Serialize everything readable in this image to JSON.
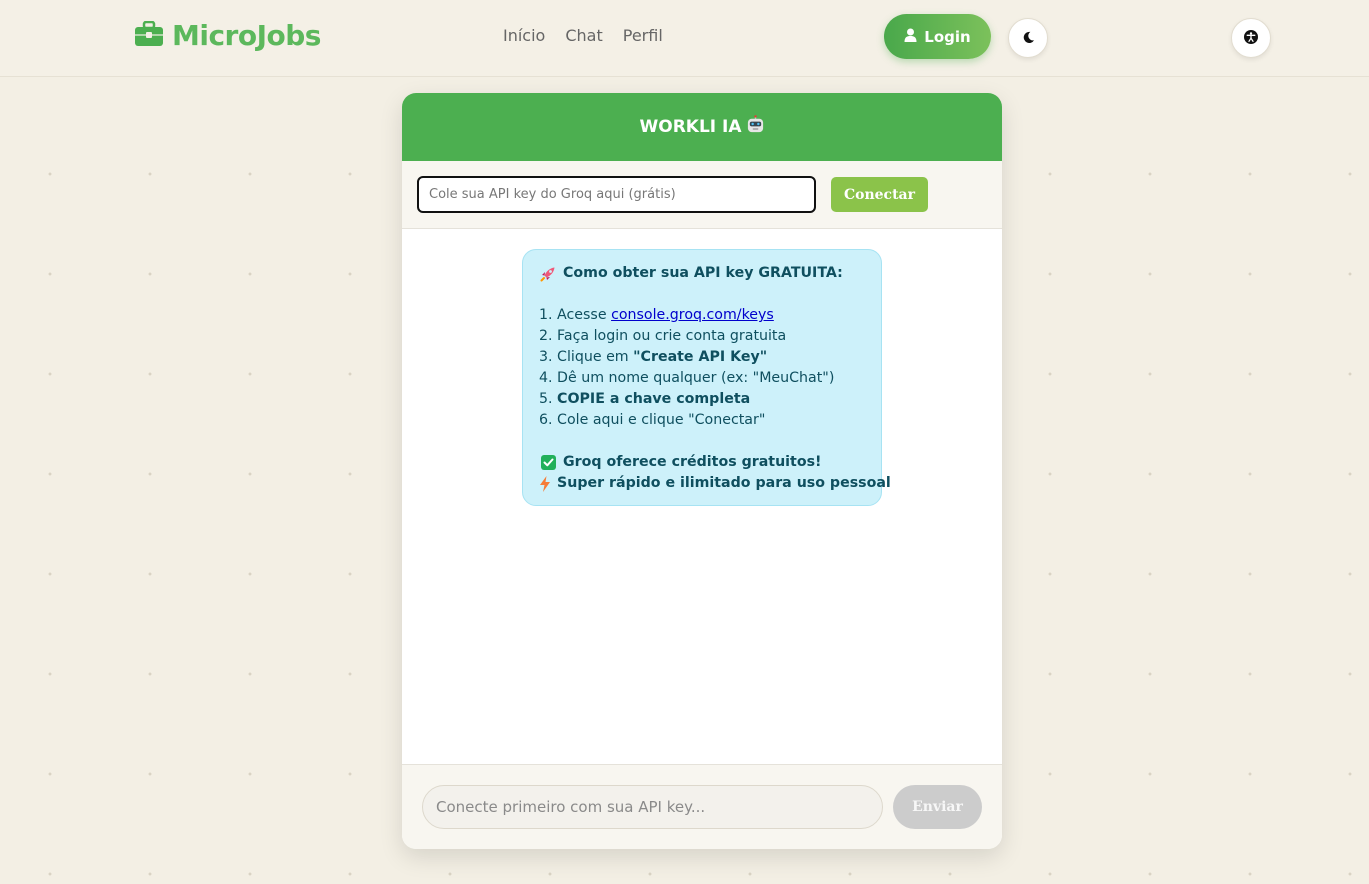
{
  "nav": {
    "brand": "MicroJobs",
    "links": [
      "Início",
      "Chat",
      "Perfil"
    ],
    "login_label": "Login"
  },
  "chat": {
    "title": "WORKLI IA",
    "api_placeholder": "Cole sua API key do Groq aqui (grátis)",
    "connect_label": "Conectar",
    "info": {
      "heading": "Como obter sua API key GRATUITA:",
      "step1_prefix": "1. Acesse ",
      "step1_link": "console.groq.com/keys",
      "step2": "2. Faça login ou crie conta gratuita",
      "step3_prefix": "3. Clique em ",
      "step3_bold": "\"Create API Key\"",
      "step4": "4. Dê um nome qualquer (ex: \"MeuChat\")",
      "step5_prefix": "5. ",
      "step5_bold": "COPIE a chave completa",
      "step6": "6. Cole aqui e clique \"Conectar\"",
      "note1": "Groq oferece créditos gratuitos!",
      "note2": "Super rápido e ilimitado para uso pessoal"
    },
    "message_placeholder": "Conecte primeiro com sua API key...",
    "send_label": "Enviar"
  },
  "icons": {
    "brand": "briefcase-icon",
    "login": "user-icon",
    "theme": "moon-icon",
    "accessibility": "accessibility-icon",
    "title": "robot-icon",
    "heading": "rocket-icon",
    "note1": "check-box-icon",
    "note2": "lightning-icon"
  },
  "colors": {
    "brand_green": "#5cb85c",
    "header_green": "#4caf50",
    "connect_green": "#8bc34a",
    "info_bg": "#cdf1fa",
    "info_text": "#0f4f5f",
    "page_bg": "#f3efe4",
    "send_disabled": "#cccccc"
  }
}
